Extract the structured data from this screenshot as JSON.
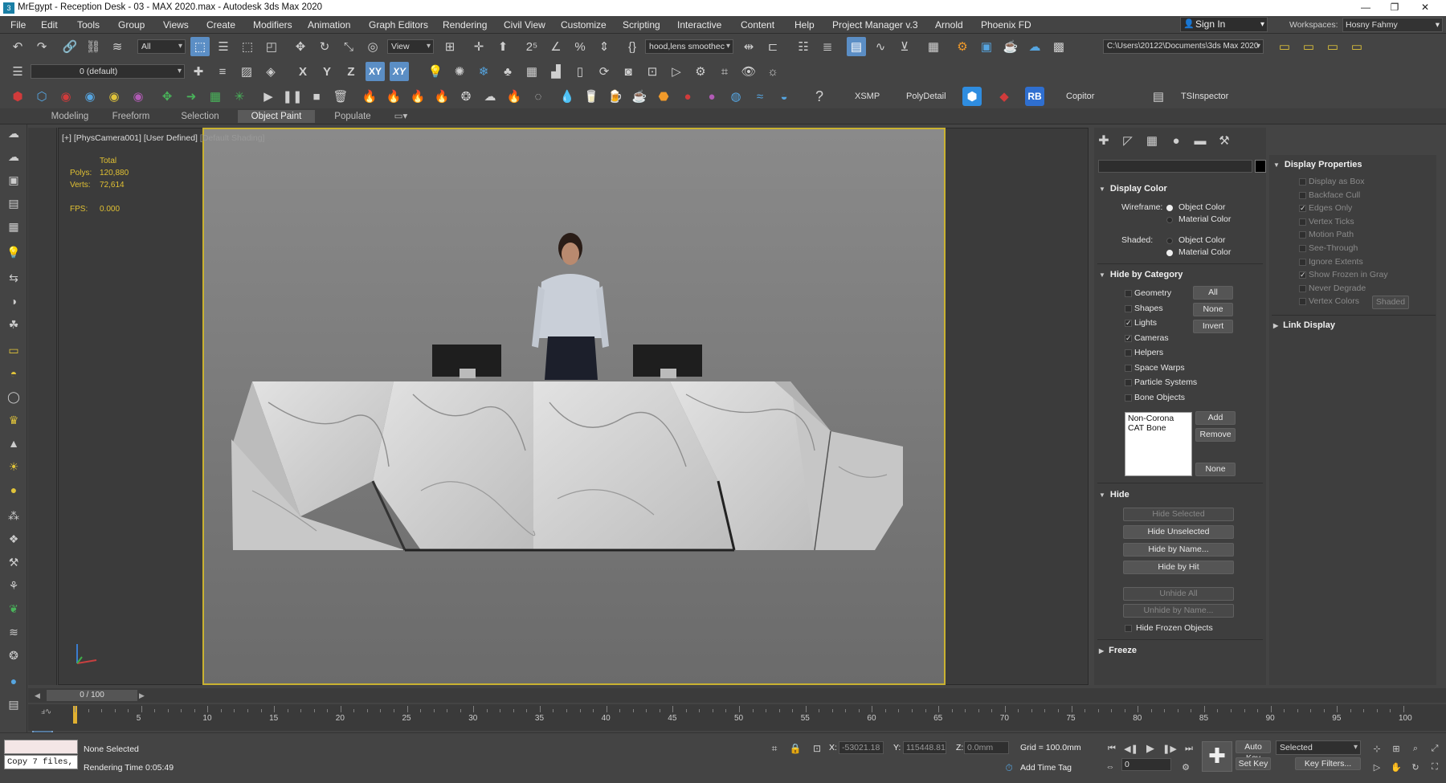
{
  "window": {
    "title": "MrEgypt - Reception Desk - 03 - MAX 2020.max - Autodesk 3ds Max 2020",
    "minimize": "—",
    "maximize": "❐",
    "close": "✕"
  },
  "menu": {
    "items": [
      "File",
      "Edit",
      "Tools",
      "Group",
      "Views",
      "Create",
      "Modifiers",
      "Animation",
      "Graph Editors",
      "Rendering",
      "Civil View",
      "Customize",
      "Scripting",
      "Interactive",
      "Content",
      "Help",
      "Project Manager v.3",
      "Arnold",
      "Phoenix FD"
    ],
    "sign_in": "Sign In",
    "workspaces_label": "Workspaces:",
    "workspace": "Hosny Fahmy"
  },
  "toolbar1": {
    "selection_filter": "All",
    "ref_coord": "View",
    "named_selection": "hood,lens smoothec",
    "project_path": "C:\\Users\\20122\\Documents\\3ds Max 2020"
  },
  "toolbar2": {
    "layer": "0 (default)",
    "axis_x": "X",
    "axis_y": "Y",
    "axis_z": "Z",
    "axis_xy": "XY",
    "axis_xy2": "XY"
  },
  "toolbar3": {
    "xsmp": "XSMP",
    "polydetail": "PolyDetail",
    "rb": "RB",
    "copitor": "Copitor",
    "tsinspector": "TSInspector"
  },
  "ribbon": {
    "tabs": [
      "Modeling",
      "Freeform",
      "Selection",
      "Object Paint",
      "Populate"
    ]
  },
  "viewport": {
    "label_plus": "[+]",
    "label_camera": "[PhysCamera001]",
    "label_view": "[User Defined]",
    "label_shading": "[Default Shading]",
    "stats_total": "Total",
    "polys_label": "Polys:",
    "polys_value": "120,880",
    "verts_label": "Verts:",
    "verts_value": "72,614",
    "fps_label": "FPS:",
    "fps_value": "0.000"
  },
  "command_panel": {
    "display_color": {
      "header": "Display Color",
      "wireframe_label": "Wireframe:",
      "shaded_label": "Shaded:",
      "object_color": "Object Color",
      "material_color": "Material Color",
      "wireframe_selected": "Object Color",
      "shaded_selected": "Material Color"
    },
    "hide_by_category": {
      "header": "Hide by Category",
      "items": [
        {
          "label": "Geometry",
          "checked": false
        },
        {
          "label": "Shapes",
          "checked": false
        },
        {
          "label": "Lights",
          "checked": true
        },
        {
          "label": "Cameras",
          "checked": true
        },
        {
          "label": "Helpers",
          "checked": false
        },
        {
          "label": "Space Warps",
          "checked": false
        },
        {
          "label": "Particle Systems",
          "checked": false
        },
        {
          "label": "Bone Objects",
          "checked": false
        }
      ],
      "all": "All",
      "none": "None",
      "invert": "Invert",
      "list": [
        "Non-Corona",
        "CAT Bone"
      ],
      "add": "Add",
      "remove": "Remove",
      "none2": "None"
    },
    "hide": {
      "header": "Hide",
      "hide_selected": "Hide Selected",
      "hide_unselected": "Hide Unselected",
      "hide_by_name": "Hide by Name...",
      "hide_by_hit": "Hide by Hit",
      "unhide_all": "Unhide All",
      "unhide_by_name": "Unhide by Name...",
      "hide_frozen": "Hide Frozen Objects"
    },
    "freeze": {
      "header": "Freeze"
    }
  },
  "display_properties": {
    "header": "Display Properties",
    "items": [
      {
        "label": "Display as Box",
        "checked": false
      },
      {
        "label": "Backface Cull",
        "checked": false
      },
      {
        "label": "Edges Only",
        "checked": true
      },
      {
        "label": "Vertex Ticks",
        "checked": false
      },
      {
        "label": "Motion Path",
        "checked": false
      },
      {
        "label": "See-Through",
        "checked": false
      },
      {
        "label": "Ignore Extents",
        "checked": false
      },
      {
        "label": "Show Frozen in Gray",
        "checked": true
      },
      {
        "label": "Never Degrade",
        "checked": false
      },
      {
        "label": "Vertex Colors",
        "checked": false
      }
    ],
    "shaded_button": "Shaded",
    "link_display": "Link Display"
  },
  "timeline": {
    "slider": "0 / 100",
    "ticks": [
      "0",
      "5",
      "10",
      "15",
      "20",
      "25",
      "30",
      "35",
      "40",
      "45",
      "50",
      "55",
      "60",
      "65",
      "70",
      "75",
      "80",
      "85",
      "90",
      "95",
      "100"
    ]
  },
  "status": {
    "maxscript": "Copy 7 files,",
    "selection": "None Selected",
    "render_time": "Rendering Time  0:05:49",
    "x_label": "X:",
    "x_value": "-53021.18",
    "y_label": "Y:",
    "y_value": "115448.81",
    "z_label": "Z:",
    "z_value": "0.0mm",
    "grid": "Grid = 100.0mm",
    "add_time_tag": "Add Time Tag",
    "frame": "0",
    "auto_key": "Auto Key",
    "set_key": "Set Key",
    "key_mode": "Selected",
    "key_filters": "Key Filters..."
  }
}
